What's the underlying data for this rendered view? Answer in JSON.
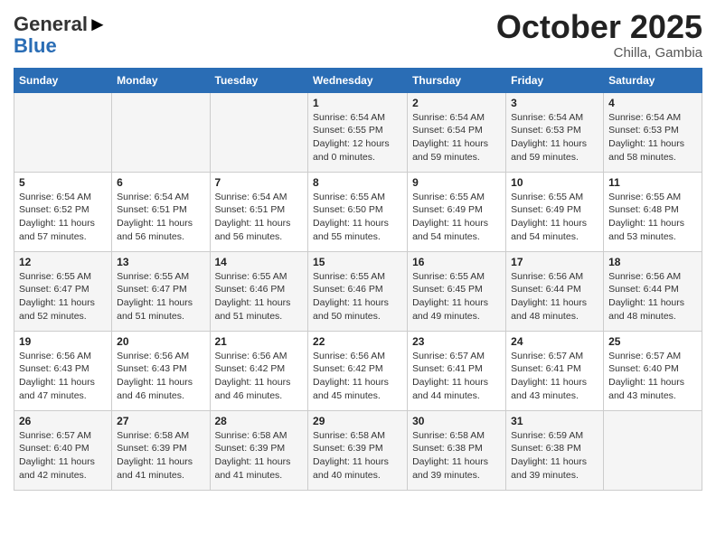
{
  "header": {
    "logo_line1": "General",
    "logo_line2": "Blue",
    "month": "October 2025",
    "location": "Chilla, Gambia"
  },
  "days_of_week": [
    "Sunday",
    "Monday",
    "Tuesday",
    "Wednesday",
    "Thursday",
    "Friday",
    "Saturday"
  ],
  "weeks": [
    [
      {
        "day": "",
        "content": ""
      },
      {
        "day": "",
        "content": ""
      },
      {
        "day": "",
        "content": ""
      },
      {
        "day": "1",
        "content": "Sunrise: 6:54 AM\nSunset: 6:55 PM\nDaylight: 12 hours\nand 0 minutes."
      },
      {
        "day": "2",
        "content": "Sunrise: 6:54 AM\nSunset: 6:54 PM\nDaylight: 11 hours\nand 59 minutes."
      },
      {
        "day": "3",
        "content": "Sunrise: 6:54 AM\nSunset: 6:53 PM\nDaylight: 11 hours\nand 59 minutes."
      },
      {
        "day": "4",
        "content": "Sunrise: 6:54 AM\nSunset: 6:53 PM\nDaylight: 11 hours\nand 58 minutes."
      }
    ],
    [
      {
        "day": "5",
        "content": "Sunrise: 6:54 AM\nSunset: 6:52 PM\nDaylight: 11 hours\nand 57 minutes."
      },
      {
        "day": "6",
        "content": "Sunrise: 6:54 AM\nSunset: 6:51 PM\nDaylight: 11 hours\nand 56 minutes."
      },
      {
        "day": "7",
        "content": "Sunrise: 6:54 AM\nSunset: 6:51 PM\nDaylight: 11 hours\nand 56 minutes."
      },
      {
        "day": "8",
        "content": "Sunrise: 6:55 AM\nSunset: 6:50 PM\nDaylight: 11 hours\nand 55 minutes."
      },
      {
        "day": "9",
        "content": "Sunrise: 6:55 AM\nSunset: 6:49 PM\nDaylight: 11 hours\nand 54 minutes."
      },
      {
        "day": "10",
        "content": "Sunrise: 6:55 AM\nSunset: 6:49 PM\nDaylight: 11 hours\nand 54 minutes."
      },
      {
        "day": "11",
        "content": "Sunrise: 6:55 AM\nSunset: 6:48 PM\nDaylight: 11 hours\nand 53 minutes."
      }
    ],
    [
      {
        "day": "12",
        "content": "Sunrise: 6:55 AM\nSunset: 6:47 PM\nDaylight: 11 hours\nand 52 minutes."
      },
      {
        "day": "13",
        "content": "Sunrise: 6:55 AM\nSunset: 6:47 PM\nDaylight: 11 hours\nand 51 minutes."
      },
      {
        "day": "14",
        "content": "Sunrise: 6:55 AM\nSunset: 6:46 PM\nDaylight: 11 hours\nand 51 minutes."
      },
      {
        "day": "15",
        "content": "Sunrise: 6:55 AM\nSunset: 6:46 PM\nDaylight: 11 hours\nand 50 minutes."
      },
      {
        "day": "16",
        "content": "Sunrise: 6:55 AM\nSunset: 6:45 PM\nDaylight: 11 hours\nand 49 minutes."
      },
      {
        "day": "17",
        "content": "Sunrise: 6:56 AM\nSunset: 6:44 PM\nDaylight: 11 hours\nand 48 minutes."
      },
      {
        "day": "18",
        "content": "Sunrise: 6:56 AM\nSunset: 6:44 PM\nDaylight: 11 hours\nand 48 minutes."
      }
    ],
    [
      {
        "day": "19",
        "content": "Sunrise: 6:56 AM\nSunset: 6:43 PM\nDaylight: 11 hours\nand 47 minutes."
      },
      {
        "day": "20",
        "content": "Sunrise: 6:56 AM\nSunset: 6:43 PM\nDaylight: 11 hours\nand 46 minutes."
      },
      {
        "day": "21",
        "content": "Sunrise: 6:56 AM\nSunset: 6:42 PM\nDaylight: 11 hours\nand 46 minutes."
      },
      {
        "day": "22",
        "content": "Sunrise: 6:56 AM\nSunset: 6:42 PM\nDaylight: 11 hours\nand 45 minutes."
      },
      {
        "day": "23",
        "content": "Sunrise: 6:57 AM\nSunset: 6:41 PM\nDaylight: 11 hours\nand 44 minutes."
      },
      {
        "day": "24",
        "content": "Sunrise: 6:57 AM\nSunset: 6:41 PM\nDaylight: 11 hours\nand 43 minutes."
      },
      {
        "day": "25",
        "content": "Sunrise: 6:57 AM\nSunset: 6:40 PM\nDaylight: 11 hours\nand 43 minutes."
      }
    ],
    [
      {
        "day": "26",
        "content": "Sunrise: 6:57 AM\nSunset: 6:40 PM\nDaylight: 11 hours\nand 42 minutes."
      },
      {
        "day": "27",
        "content": "Sunrise: 6:58 AM\nSunset: 6:39 PM\nDaylight: 11 hours\nand 41 minutes."
      },
      {
        "day": "28",
        "content": "Sunrise: 6:58 AM\nSunset: 6:39 PM\nDaylight: 11 hours\nand 41 minutes."
      },
      {
        "day": "29",
        "content": "Sunrise: 6:58 AM\nSunset: 6:39 PM\nDaylight: 11 hours\nand 40 minutes."
      },
      {
        "day": "30",
        "content": "Sunrise: 6:58 AM\nSunset: 6:38 PM\nDaylight: 11 hours\nand 39 minutes."
      },
      {
        "day": "31",
        "content": "Sunrise: 6:59 AM\nSunset: 6:38 PM\nDaylight: 11 hours\nand 39 minutes."
      },
      {
        "day": "",
        "content": ""
      }
    ]
  ]
}
